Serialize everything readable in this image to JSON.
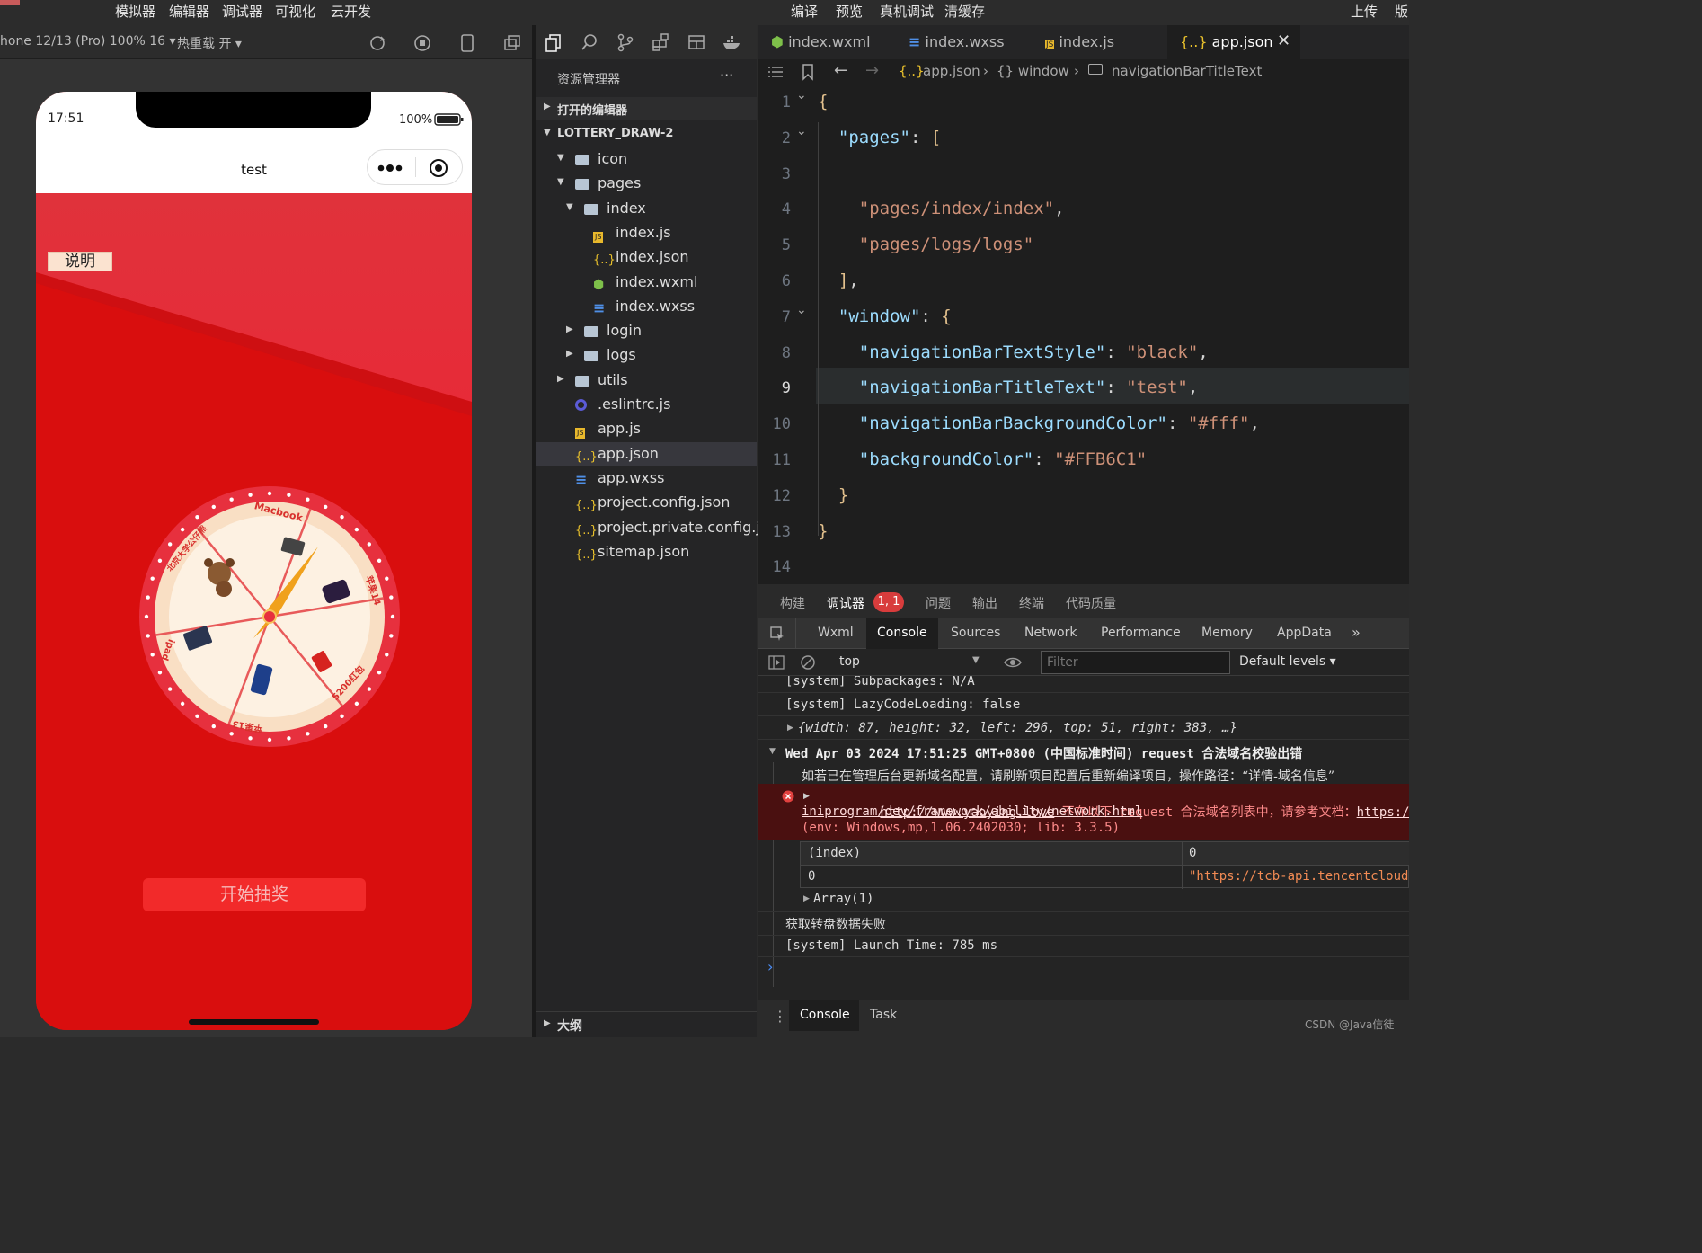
{
  "menu": {
    "left_items": [
      "模拟器",
      "编辑器",
      "调试器",
      "可视化",
      "云开发"
    ],
    "center_items": [
      "编译",
      "预览",
      "真机调试",
      "清缓存"
    ],
    "upload": "上传",
    "version": "版"
  },
  "sim_toolbar": {
    "device": "hone 12/13 (Pro) 100% 16 ▾",
    "hot_reload": "热重载 开 ▾"
  },
  "phone": {
    "time": "17:51",
    "battery": "100%",
    "nav_title": "test",
    "explain_button": "说明",
    "start_button": "开始抽奖",
    "wheel_prizes": [
      "Macbook",
      "苹果14",
      "5200红包",
      "苹果13",
      "ipad",
      "北京大学公仔熊"
    ]
  },
  "explorer": {
    "title": "资源管理器",
    "more": "···",
    "open_editors": "打开的编辑器",
    "project": "LOTTERY_DRAW-2",
    "tree": [
      {
        "label": "icon",
        "kind": "folder",
        "icon": "folder-icon"
      },
      {
        "label": "pages",
        "kind": "folder",
        "icon": "folder-icon"
      },
      {
        "label": "index",
        "kind": "folder",
        "icon": "folder-icon"
      },
      {
        "label": "index.js",
        "kind": "js",
        "icon": "js-file-icon"
      },
      {
        "label": "index.json",
        "kind": "json",
        "icon": "json-file-icon"
      },
      {
        "label": "index.wxml",
        "kind": "wxml",
        "icon": "wxml-file-icon"
      },
      {
        "label": "index.wxss",
        "kind": "wxss",
        "icon": "wxss-file-icon"
      },
      {
        "label": "login",
        "kind": "folder",
        "icon": "folder-icon"
      },
      {
        "label": "logs",
        "kind": "folder",
        "icon": "folder-icon"
      },
      {
        "label": "utils",
        "kind": "folder",
        "icon": "folder-icon"
      },
      {
        "label": ".eslintrc.js",
        "kind": "eslint",
        "icon": "eslint-file-icon"
      },
      {
        "label": "app.js",
        "kind": "js",
        "icon": "js-file-icon"
      },
      {
        "label": "app.json",
        "kind": "json",
        "icon": "json-file-icon"
      },
      {
        "label": "app.wxss",
        "kind": "wxss",
        "icon": "wxss-file-icon"
      },
      {
        "label": "project.config.json",
        "kind": "json",
        "icon": "json-file-icon"
      },
      {
        "label": "project.private.config.js...",
        "kind": "json",
        "icon": "json-file-icon"
      },
      {
        "label": "sitemap.json",
        "kind": "json",
        "icon": "json-file-icon"
      }
    ],
    "outline": "大纲"
  },
  "editor": {
    "tabs": [
      {
        "label": "index.wxml",
        "icon": "wxml-file-icon"
      },
      {
        "label": "index.wxss",
        "icon": "wxss-file-icon"
      },
      {
        "label": "index.js",
        "icon": "js-file-icon"
      },
      {
        "label": "app.json",
        "icon": "json-file-icon",
        "active": true
      }
    ],
    "breadcrumb": [
      "app.json",
      "{} window",
      "navigationBarTitleText"
    ],
    "lines": [
      {
        "n": "1",
        "text": "{"
      },
      {
        "n": "2",
        "text": "  \"pages\": ["
      },
      {
        "n": "3",
        "text": ""
      },
      {
        "n": "4",
        "text": "    \"pages/index/index\","
      },
      {
        "n": "5",
        "text": "    \"pages/logs/logs\""
      },
      {
        "n": "6",
        "text": "  ],"
      },
      {
        "n": "7",
        "text": "  \"window\": {"
      },
      {
        "n": "8",
        "text": "    \"navigationBarTextStyle\": \"black\","
      },
      {
        "n": "9",
        "text": "    \"navigationBarTitleText\": \"test\","
      },
      {
        "n": "10",
        "text": "    \"navigationBarBackgroundColor\": \"#fff\","
      },
      {
        "n": "11",
        "text": "    \"backgroundColor\": \"#FFB6C1\""
      },
      {
        "n": "12",
        "text": "  }"
      },
      {
        "n": "13",
        "text": "}"
      },
      {
        "n": "14",
        "text": ""
      }
    ]
  },
  "devtools": {
    "panel_tabs": [
      "构建",
      "调试器",
      "问题",
      "输出",
      "终端",
      "代码质量"
    ],
    "badge": "1, 1",
    "tool_tabs": [
      "Wxml",
      "Console",
      "Sources",
      "Network",
      "Performance",
      "Memory",
      "AppData",
      "»"
    ],
    "context": "top",
    "filter_placeholder": "Filter",
    "levels": "Default levels ▾",
    "console_lines": {
      "l1": "[system] Subpackages: N/A",
      "l2": "[system] LazyCodeLoading: false",
      "l3": "{width: 87, height: 32, left: 296, top: 51, right: 383, …}",
      "l4": "Wed Apr 03 2024 17:51:25 GMT+0800 (中国标准时间) request 合法域名校验出错",
      "l5": "如若已在管理后台更新域名配置，请刷新项目配置后重新编译项目，操作路径：“详情-域名信息”",
      "err_url": "http://www.yaoying.love",
      "err_msg": " 不在以下 request 合法域名列表中，请参考文档：",
      "err_doc": "https://develop",
      "err_doc2": "iniprogram/dev/framework/ability/network.html",
      "err_env": "(env: Windows,mp,1.06.2402030; lib: 3.3.5)",
      "table_h1": "(index)",
      "table_h2": "0",
      "table_r1": "0",
      "table_r2": "\"https://tcb-api.tencentclouda",
      "array": "Array(1)",
      "l6": "获取转盘数据失败",
      "l7": "[system] Launch Time: 785 ms",
      "prompt": "›"
    },
    "bottom_tabs": [
      "Console",
      "Task"
    ],
    "watermark": "CSDN @Java信徒"
  },
  "colors": {
    "accent_red": "#d90e0e",
    "button_red": "#f22a2a",
    "string": "#ce9178",
    "key": "#9cdcfe",
    "error_bg": "#4a1010"
  }
}
